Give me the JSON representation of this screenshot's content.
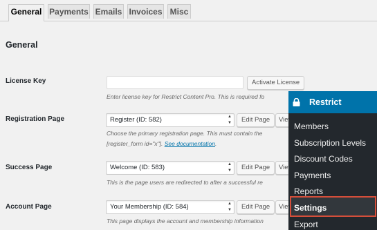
{
  "tabs": [
    "General",
    "Payments",
    "Emails",
    "Invoices",
    "Misc"
  ],
  "section_title": "General",
  "license": {
    "label": "License Key",
    "input_value": "",
    "button": "Activate License",
    "desc": "Enter license key for Restrict Content Pro. This is required fo"
  },
  "registration": {
    "label": "Registration Page",
    "select": "Register (ID: 582)",
    "edit": "Edit Page",
    "view": "View",
    "desc1": "Choose the primary registration page. This must contain the",
    "desc2": "[register_form id=\"x\"].",
    "doc_link": "See documentation"
  },
  "success": {
    "label": "Success Page",
    "select": "Welcome (ID: 583)",
    "edit": "Edit Page",
    "view": "View",
    "desc": "This is the page users are redirected to after a successful re"
  },
  "account": {
    "label": "Account Page",
    "select": "Your Membership (ID: 584)",
    "edit": "Edit Page",
    "view": "View",
    "desc": "This page displays the account and membership information"
  },
  "menu": {
    "title": "Restrict",
    "items": [
      "Members",
      "Subscription Levels",
      "Discount Codes",
      "Payments",
      "Reports",
      "Settings",
      "Export"
    ],
    "current": "Settings"
  },
  "colors": {
    "menu_bg": "#23282d",
    "menu_head": "#0073aa",
    "highlight_border": "#d54e3a",
    "link": "#0073aa"
  }
}
